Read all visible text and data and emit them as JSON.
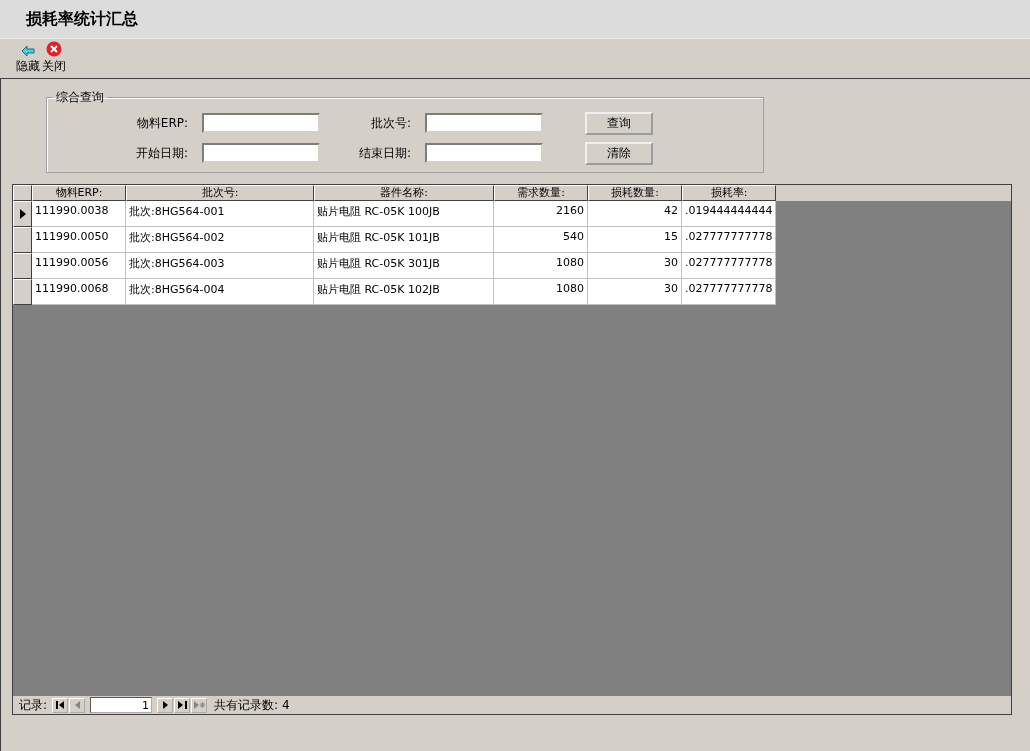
{
  "window": {
    "title": "损耗率统计汇总"
  },
  "toolbar": [
    {
      "kind": "hide",
      "label": "隐藏"
    },
    {
      "kind": "close",
      "label": "关闭"
    }
  ],
  "query": {
    "legend": "综合查询",
    "fields": [
      {
        "label": "物料ERP:"
      },
      {
        "label": "批次号:"
      },
      {
        "label": "开始日期:"
      },
      {
        "label": "结束日期:"
      }
    ],
    "buttons": [
      "查询",
      "清除"
    ]
  },
  "table": {
    "columns": [
      "物料ERP:",
      "批次号:",
      "器件名称:",
      "需求数量:",
      "损耗数量:",
      "损耗率:"
    ],
    "rows": [
      {
        "selected": true,
        "cells": [
          "111990.0038",
          "批次:8HG564-001",
          "贴片电阻 RC-05K 100JB",
          "2160",
          "42",
          ".019444444444"
        ]
      },
      {
        "selected": false,
        "cells": [
          "111990.0050",
          "批次:8HG564-002",
          "贴片电阻 RC-05K 101JB",
          "540",
          "15",
          ".027777777778"
        ]
      },
      {
        "selected": false,
        "cells": [
          "111990.0056",
          "批次:8HG564-003",
          "贴片电阻 RC-05K 301JB",
          "1080",
          "30",
          ".027777777778"
        ]
      },
      {
        "selected": false,
        "cells": [
          "111990.0068",
          "批次:8HG564-004",
          "贴片电阻 RC-05K 102JB",
          "1080",
          "30",
          ".027777777778"
        ]
      }
    ]
  },
  "navigator": {
    "label": "记录:",
    "current": "1",
    "total": "共有记录数: 4"
  }
}
